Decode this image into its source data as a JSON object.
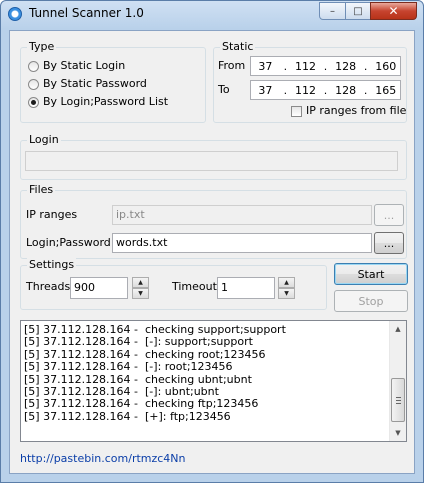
{
  "window": {
    "title": "Tunnel Scanner 1.0",
    "min_glyph": "–",
    "max_glyph": "□",
    "close_glyph": "✕"
  },
  "type_group": {
    "title": "Type",
    "options": [
      {
        "label": "By Static Login",
        "selected": false
      },
      {
        "label": "By Static Password",
        "selected": false
      },
      {
        "label": "By Login;Password List",
        "selected": true
      }
    ]
  },
  "static_group": {
    "title": "Static",
    "from_label": "From",
    "from_ip": [
      "37",
      "112",
      "128",
      "160"
    ],
    "to_label": "To",
    "to_ip": [
      "37",
      "112",
      "128",
      "165"
    ],
    "ip_dot": ".",
    "ip_ranges_from_file_label": "IP ranges from file",
    "ip_ranges_from_file_checked": false
  },
  "login_group": {
    "title": "Login",
    "value": ""
  },
  "files_group": {
    "title": "Files",
    "ip_ranges_label": "IP ranges",
    "ip_ranges_value": "ip.txt",
    "login_password_label": "Login;Password",
    "login_password_value": "words.txt",
    "browse_label": "..."
  },
  "settings_group": {
    "title": "Settings",
    "threads_label": "Threads",
    "threads_value": "900",
    "timeout_label": "Timeout",
    "timeout_value": "1",
    "spin_up": "▲",
    "spin_down": "▼"
  },
  "buttons": {
    "start": "Start",
    "stop": "Stop"
  },
  "log": [
    "[5] 37.112.128.164 -  checking support;support",
    "[5] 37.112.128.164 -  [-]: support;support",
    "[5] 37.112.128.164 -  checking root;123456",
    "[5] 37.112.128.164 -  [-]: root;123456",
    "[5] 37.112.128.164 -  checking ubnt;ubnt",
    "[5] 37.112.128.164 -  [-]: ubnt;ubnt",
    "[5] 37.112.128.164 -  checking ftp;123456",
    "[5] 37.112.128.164 -  [+]: ftp;123456"
  ],
  "scrollbar": {
    "up": "▲",
    "down": "▼"
  },
  "footer_link": "http://pastebin.com/rtmzc4Nn",
  "colors": {
    "link": "#0b3ea8",
    "close_button": "#c7442f"
  }
}
